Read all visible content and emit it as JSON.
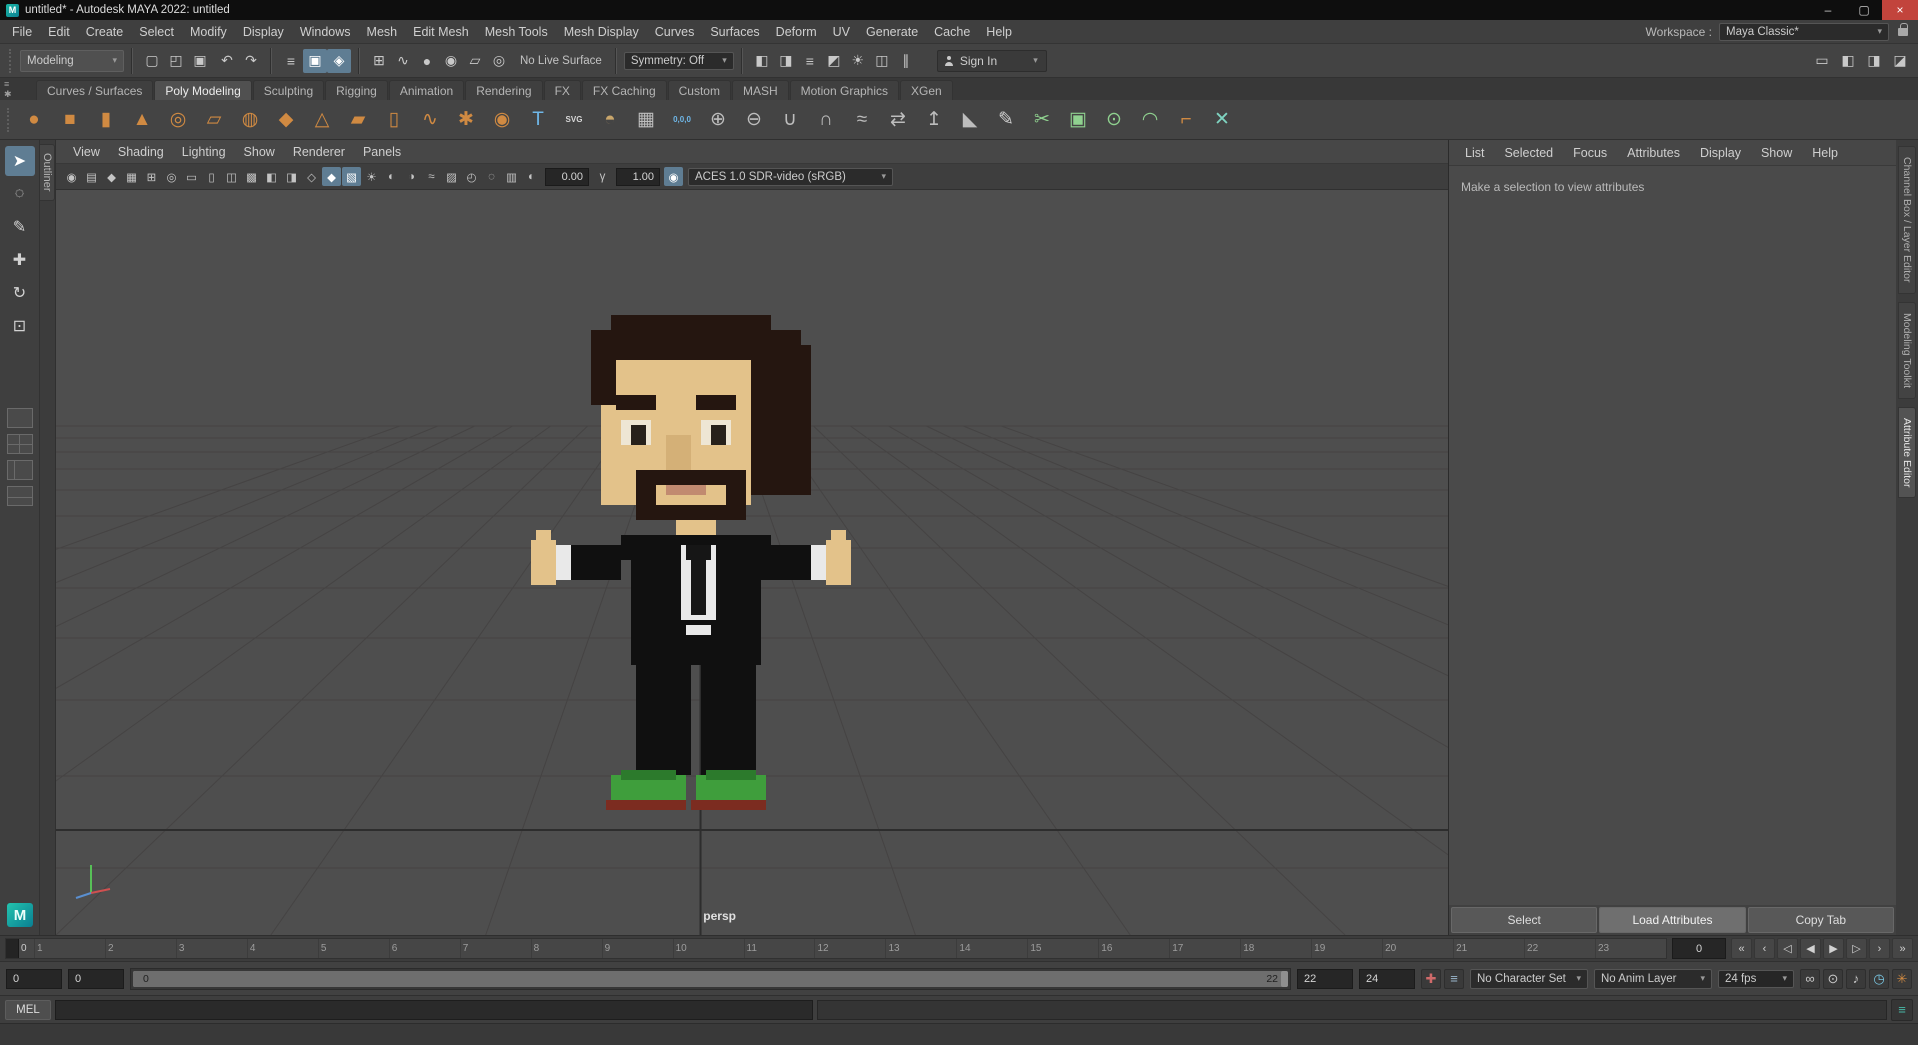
{
  "window": {
    "title": "untitled* - Autodesk MAYA 2022: untitled",
    "logo_glyph": "M",
    "controls": [
      {
        "name": "minimize-button",
        "glyph": "–",
        "variant": "default"
      },
      {
        "name": "maximize-button",
        "glyph": "▢",
        "variant": "default"
      },
      {
        "name": "close-button",
        "glyph": "×",
        "variant": "close"
      }
    ]
  },
  "menu_bar": {
    "items": [
      "File",
      "Edit",
      "Create",
      "Select",
      "Modify",
      "Display",
      "Windows",
      "Mesh",
      "Edit Mesh",
      "Mesh Tools",
      "Mesh Display",
      "Curves",
      "Surfaces",
      "Deform",
      "UV",
      "Generate",
      "Cache",
      "Help"
    ],
    "workspace_label": "Workspace :",
    "workspace_value": "Maya Classic*"
  },
  "status_line": {
    "menu_set": "Modeling",
    "file_icons": [
      {
        "name": "new-scene-icon",
        "glyph": "▢"
      },
      {
        "name": "open-scene-icon",
        "glyph": "◰"
      },
      {
        "name": "save-scene-icon",
        "glyph": "▣"
      }
    ],
    "history_icons": [
      {
        "name": "undo-icon",
        "glyph": "↶"
      },
      {
        "name": "redo-icon",
        "glyph": "↷"
      }
    ],
    "selection_icons": [
      {
        "name": "select-hierarchy-icon",
        "glyph": "≡",
        "active": false
      },
      {
        "name": "select-object-icon",
        "glyph": "▣",
        "active": true
      },
      {
        "name": "select-component-icon",
        "glyph": "◈",
        "active": true
      }
    ],
    "snap_icons": [
      {
        "name": "snap-to-grid-icon",
        "glyph": "⊞"
      },
      {
        "name": "snap-to-curve-icon",
        "glyph": "∿"
      },
      {
        "name": "snap-to-point-icon",
        "glyph": "●"
      },
      {
        "name": "snap-to-projected-center-icon",
        "glyph": "◉"
      },
      {
        "name": "snap-to-view-plane-icon",
        "glyph": "▱"
      },
      {
        "name": "make-live-icon",
        "glyph": "◎"
      }
    ],
    "live_surface_label": "No Live Surface",
    "symmetry_label": "Symmetry: Off",
    "render_icons": [
      {
        "name": "render-frame-icon",
        "glyph": "◧"
      },
      {
        "name": "ipr-render-icon",
        "glyph": "◨"
      },
      {
        "name": "render-settings-icon",
        "glyph": "≡"
      },
      {
        "name": "hypershade-icon",
        "glyph": "◩"
      },
      {
        "name": "light-editor-icon",
        "glyph": "☀"
      },
      {
        "name": "lookdev-icon",
        "glyph": "◫"
      },
      {
        "name": "pause-viewport-icon",
        "glyph": "∥"
      }
    ],
    "sign_in_label": "Sign In",
    "panel_toggle_icons": [
      {
        "name": "single-pane-toggle-icon",
        "glyph": "▭"
      },
      {
        "name": "tool-settings-toggle-icon",
        "glyph": "◧"
      },
      {
        "name": "attribute-editor-toggle-icon",
        "glyph": "◨"
      },
      {
        "name": "channel-box-toggle-icon",
        "glyph": "◪"
      }
    ]
  },
  "shelf": {
    "menu_icons": [
      {
        "name": "shelf-tab-menu-icon",
        "glyph": "≡"
      },
      {
        "name": "shelf-gear-icon",
        "glyph": "✱"
      }
    ],
    "tabs": [
      {
        "label": "Curves / Surfaces",
        "active": false
      },
      {
        "label": "Poly Modeling",
        "active": true
      },
      {
        "label": "Sculpting",
        "active": false
      },
      {
        "label": "Rigging",
        "active": false
      },
      {
        "label": "Animation",
        "active": false
      },
      {
        "label": "Rendering",
        "active": false
      },
      {
        "label": "FX",
        "active": false
      },
      {
        "label": "FX Caching",
        "active": false
      },
      {
        "label": "Custom",
        "active": false
      },
      {
        "label": "MASH",
        "active": false
      },
      {
        "label": "Motion Graphics",
        "active": false
      },
      {
        "label": "XGen",
        "active": false
      }
    ],
    "items": [
      {
        "name": "poly-sphere-icon",
        "glyph": "●",
        "color": "#d08a42"
      },
      {
        "name": "poly-cube-icon",
        "glyph": "■",
        "color": "#d08a42"
      },
      {
        "name": "poly-cylinder-icon",
        "glyph": "▮",
        "color": "#d08a42"
      },
      {
        "name": "poly-cone-icon",
        "glyph": "▲",
        "color": "#d08a42"
      },
      {
        "name": "poly-torus-icon",
        "glyph": "◎",
        "color": "#d08a42"
      },
      {
        "name": "poly-plane-icon",
        "glyph": "▱",
        "color": "#d08a42"
      },
      {
        "name": "poly-disc-icon",
        "glyph": "◍",
        "color": "#d08a42"
      },
      {
        "name": "poly-platonic-icon",
        "glyph": "◆",
        "color": "#d08a42"
      },
      {
        "name": "poly-pyramid-icon",
        "glyph": "△",
        "color": "#d08a42"
      },
      {
        "name": "poly-prism-icon",
        "glyph": "▰",
        "color": "#d08a42"
      },
      {
        "name": "poly-pipe-icon",
        "glyph": "▯",
        "color": "#d08a42"
      },
      {
        "name": "poly-helix-icon",
        "glyph": "∿",
        "color": "#d08a42"
      },
      {
        "name": "poly-gear-icon",
        "glyph": "✱",
        "color": "#d08a42"
      },
      {
        "name": "poly-soccer-ball-icon",
        "glyph": "◉",
        "color": "#d08a42"
      },
      {
        "name": "poly-type-icon",
        "glyph": "T",
        "color": "#6fb7e8"
      },
      {
        "name": "svg-tool-icon",
        "glyph": "SVG",
        "color": "#d8d8d8",
        "small": true
      },
      {
        "name": "sculpt-tool-icon",
        "glyph": "◓",
        "color": "#c9a66b"
      },
      {
        "name": "construction-plane-icon",
        "glyph": "▦",
        "color": "#bdbdbd"
      },
      {
        "name": "snap-to-origin-icon",
        "glyph": "0,0,0",
        "color": "#6fb7e8",
        "small": true
      },
      {
        "name": "combine-icon",
        "glyph": "⊕",
        "color": "#bdbdbd"
      },
      {
        "name": "separate-icon",
        "glyph": "⊖",
        "color": "#bdbdbd"
      },
      {
        "name": "boolean-union-icon",
        "glyph": "∪",
        "color": "#bdbdbd"
      },
      {
        "name": "boolean-difference-icon",
        "glyph": "∩",
        "color": "#bdbdbd"
      },
      {
        "name": "smooth-icon",
        "glyph": "≈",
        "color": "#bdbdbd"
      },
      {
        "name": "mirror-icon",
        "glyph": "⇄",
        "color": "#bdbdbd"
      },
      {
        "name": "extrude-icon",
        "glyph": "↥",
        "color": "#bdbdbd"
      },
      {
        "name": "bevel-icon",
        "glyph": "◣",
        "color": "#bdbdbd"
      },
      {
        "name": "pencil-curve-icon",
        "glyph": "✎",
        "color": "#cfcfcf"
      },
      {
        "name": "multi-cut-icon",
        "glyph": "✂",
        "color": "#8fd18f"
      },
      {
        "name": "quad-draw-icon",
        "glyph": "▣",
        "color": "#8fd18f"
      },
      {
        "name": "target-weld-icon",
        "glyph": "⊙",
        "color": "#8fd18f"
      },
      {
        "name": "bridge-icon",
        "glyph": "◠",
        "color": "#8fd18f"
      },
      {
        "name": "curve-arc-icon",
        "glyph": "⌐",
        "color": "#d08a42"
      },
      {
        "name": "delete-component-icon",
        "glyph": "✕",
        "color": "#7fd4c1"
      }
    ]
  },
  "toolbox": {
    "tools": [
      {
        "name": "select-tool",
        "glyph": "➤",
        "active": true
      },
      {
        "name": "lasso-select-tool",
        "glyph": "◌",
        "active": false
      },
      {
        "name": "paint-select-tool",
        "glyph": "✎",
        "active": false
      },
      {
        "name": "move-tool",
        "glyph": "✚",
        "active": false
      },
      {
        "name": "rotate-tool",
        "glyph": "↻",
        "active": false
      },
      {
        "name": "scale-tool",
        "glyph": "⊡",
        "active": false
      }
    ],
    "layouts": [
      {
        "name": "layout-single-pane"
      },
      {
        "name": "layout-four-pane"
      },
      {
        "name": "layout-persp-outliner"
      },
      {
        "name": "layout-hypershade-persp"
      }
    ]
  },
  "panel_menu": {
    "items": [
      "View",
      "Shading",
      "Lighting",
      "Show",
      "Renderer",
      "Panels"
    ]
  },
  "viewport_bar": {
    "icons": [
      {
        "name": "lock-camera-icon",
        "glyph": "◉"
      },
      {
        "name": "camera-attributes-icon",
        "glyph": "▤"
      },
      {
        "name": "bookmarks-icon",
        "glyph": "◆"
      },
      {
        "name": "image-plane-icon",
        "glyph": "▦"
      },
      {
        "name": "two-d-pan-zoom-icon",
        "glyph": "⊞"
      },
      {
        "name": "oversampling-icon",
        "glyph": "◎"
      },
      {
        "name": "film-gate-icon",
        "glyph": "▭"
      },
      {
        "name": "resolution-gate-icon",
        "glyph": "▯"
      },
      {
        "name": "gate-mask-icon",
        "glyph": "◫"
      },
      {
        "name": "field-chart-icon",
        "glyph": "▩"
      },
      {
        "name": "safe-action-icon",
        "glyph": "◧"
      },
      {
        "name": "safe-title-icon",
        "glyph": "◨"
      },
      {
        "name": "wireframe-icon",
        "glyph": "◇"
      },
      {
        "name": "shaded-icon",
        "glyph": "◆",
        "active": true
      },
      {
        "name": "textured-icon",
        "glyph": "▧",
        "active": true
      },
      {
        "name": "lighting-icon",
        "glyph": "☀"
      },
      {
        "name": "shadows-icon",
        "glyph": "◐"
      },
      {
        "name": "ao-icon",
        "glyph": "◑"
      },
      {
        "name": "motion-blur-icon",
        "glyph": "≈"
      },
      {
        "name": "multisample-icon",
        "glyph": "▨"
      },
      {
        "name": "dof-icon",
        "glyph": "◴"
      },
      {
        "name": "isolate-select-icon",
        "glyph": "◌"
      },
      {
        "name": "xray-icon",
        "glyph": "▥"
      },
      {
        "name": "exposure-icon",
        "glyph": "◐"
      }
    ],
    "exposure": "0.00",
    "gamma_icon": "γ",
    "gamma": "1.00",
    "color_management_icon": "◉",
    "color_space": "ACES 1.0 SDR-video (sRGB)"
  },
  "viewport": {
    "camera_label": "persp"
  },
  "side_tabs": {
    "left": [
      {
        "label": "Outliner"
      }
    ],
    "right": [
      {
        "label": "Channel Box / Layer Editor",
        "active": false
      },
      {
        "label": "Modeling Toolkit",
        "active": false
      },
      {
        "label": "Attribute Editor",
        "active": true
      }
    ]
  },
  "attribute_editor": {
    "menu": [
      "List",
      "Selected",
      "Focus",
      "Attributes",
      "Display",
      "Show",
      "Help"
    ],
    "placeholder": "Make a selection to view attributes",
    "buttons": [
      {
        "label": "Select",
        "variant": "default"
      },
      {
        "label": "Load Attributes",
        "variant": "primary"
      },
      {
        "label": "Copy Tab",
        "variant": "default"
      }
    ]
  },
  "timeline": {
    "current_frame": "0",
    "frames": [
      "1",
      "2",
      "3",
      "4",
      "5",
      "6",
      "7",
      "8",
      "9",
      "10",
      "11",
      "12",
      "13",
      "14",
      "15",
      "16",
      "17",
      "18",
      "19",
      "20",
      "21",
      "22",
      "23"
    ],
    "current_frame_field": "0",
    "playback": [
      {
        "name": "go-to-start-button",
        "glyph": "«"
      },
      {
        "name": "step-back-frame-button",
        "glyph": "‹"
      },
      {
        "name": "step-back-key-button",
        "glyph": "◁"
      },
      {
        "name": "play-backwards-button",
        "glyph": "◀"
      },
      {
        "name": "play-forwards-button",
        "glyph": "▶"
      },
      {
        "name": "step-forward-key-button",
        "glyph": "▷"
      },
      {
        "name": "step-forward-frame-button",
        "glyph": "›"
      },
      {
        "name": "go-to-end-button",
        "glyph": "»"
      }
    ]
  },
  "range_slider": {
    "animation_start": "0",
    "playback_start": "0",
    "range_start_label": "0",
    "range_end_label": "22",
    "playback_end": "22",
    "animation_end": "24",
    "left_icons": [
      {
        "name": "set-key-icon",
        "glyph": "✚",
        "color": "#cf6a6a"
      },
      {
        "name": "anim-layer-stack-icon",
        "glyph": "≡",
        "color": "#9bb7cc"
      }
    ],
    "character_set_label": "No Character Set",
    "anim_layer_label": "No Anim Layer",
    "fps_label": "24 fps",
    "right_icons": [
      {
        "name": "playback-loop-icon",
        "glyph": "∞",
        "color": "#c9c9c9"
      },
      {
        "name": "auto-key-icon",
        "glyph": "⊙",
        "color": "#c9c9c9"
      },
      {
        "name": "sound-icon",
        "glyph": "♪",
        "color": "#c9c9c9"
      },
      {
        "name": "cached-playback-icon",
        "glyph": "◷",
        "color": "#79c7e3"
      },
      {
        "name": "animation-preferences-icon",
        "glyph": "✳",
        "color": "#d08a42"
      }
    ]
  },
  "command_line": {
    "mode_label": "MEL",
    "script_editor_icon_glyph": "≡"
  },
  "colors": {
    "accent": "#5285a6",
    "viewport_bg": "#4e4e4e",
    "shelf_orange": "#d08a42",
    "char_hair": "#251610",
    "char_skin": "#e3c28a",
    "char_suit": "#101010",
    "char_shirt": "#e9e9e9",
    "char_shoe": "#3f9e3c"
  }
}
